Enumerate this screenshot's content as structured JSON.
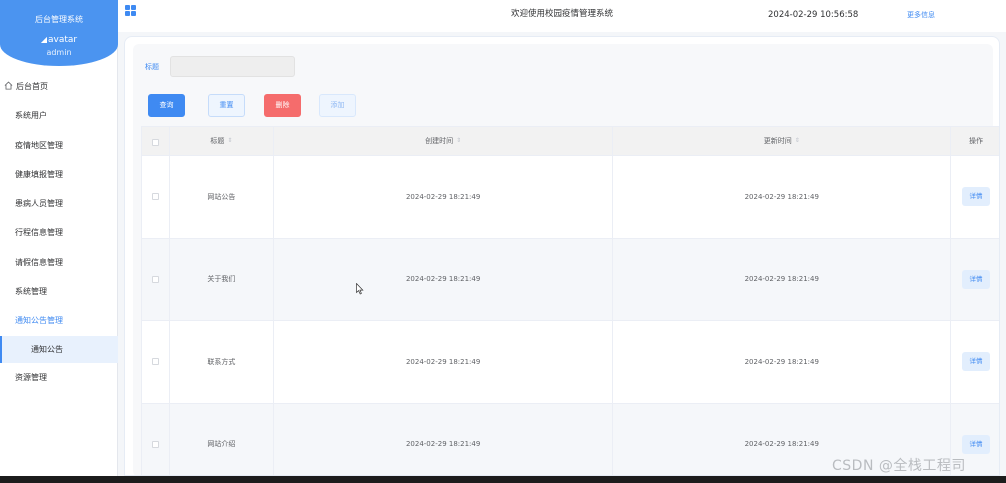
{
  "sidebar": {
    "brand_title": "后台管理系统",
    "avatar_alt": "avatar",
    "username": "admin",
    "home": "后台首页",
    "items": [
      {
        "label": "系统用户"
      },
      {
        "label": "疫情地区管理"
      },
      {
        "label": "健康填报管理"
      },
      {
        "label": "患病人员管理"
      },
      {
        "label": "行程信息管理"
      },
      {
        "label": "请假信息管理"
      },
      {
        "label": "系统管理"
      },
      {
        "label": "通知公告管理"
      }
    ],
    "submenu_active": "通知公告",
    "last_item": "资源管理",
    "accent": "#3f8af2"
  },
  "header": {
    "title": "欢迎使用校园疫情管理系统",
    "datetime": "2024-02-29 10:56:58",
    "more": "更多信息",
    "menu_icon": "grid-icon"
  },
  "filter": {
    "label": "标题",
    "value": "",
    "placeholder": ""
  },
  "toolbar": {
    "search": "查询",
    "reset": "重置",
    "delete": "删除",
    "add": "添加"
  },
  "table": {
    "columns": {
      "title": "标题",
      "created": "创建时间",
      "updated": "更新时间",
      "op": "操作"
    },
    "rows": [
      {
        "title": "网站公告",
        "created": "2024-02-29 18:21:49",
        "updated": "2024-02-29 18:21:49",
        "action": "详情"
      },
      {
        "title": "关于我们",
        "created": "2024-02-29 18:21:49",
        "updated": "2024-02-29 18:21:49",
        "action": "详情"
      },
      {
        "title": "联系方式",
        "created": "2024-02-29 18:21:49",
        "updated": "2024-02-29 18:21:49",
        "action": "详情"
      },
      {
        "title": "网站介绍",
        "created": "2024-02-29 18:21:49",
        "updated": "2024-02-29 18:21:49",
        "action": "详情"
      }
    ]
  },
  "watermark": "CSDN @全栈工程司"
}
